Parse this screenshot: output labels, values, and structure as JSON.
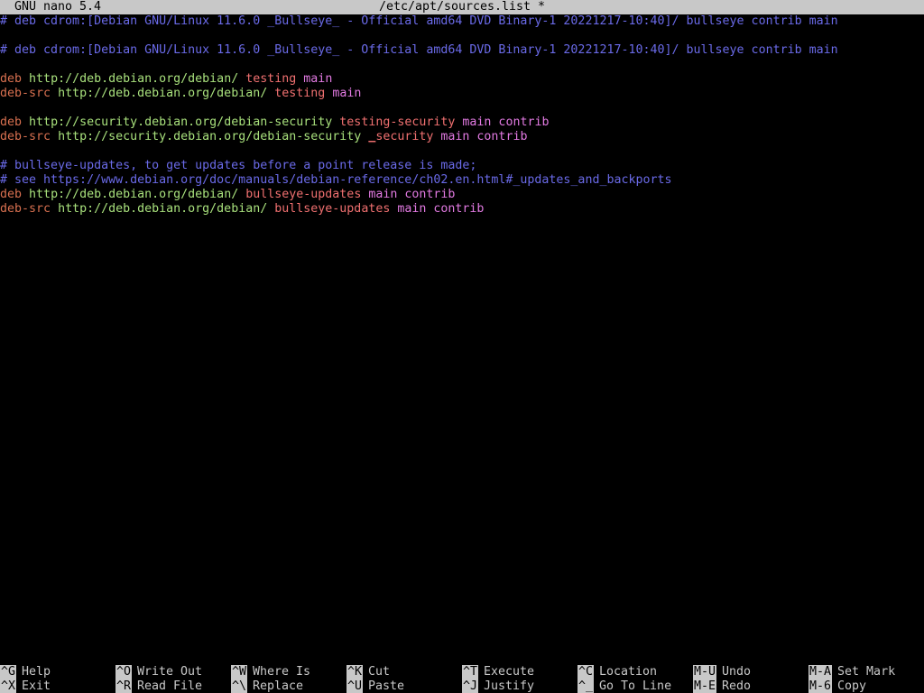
{
  "titlebar": {
    "app": "GNU nano 5.4",
    "file": "/etc/apt/sources.list *"
  },
  "editor": {
    "lines": [
      {
        "comment": "# deb cdrom:[Debian GNU/Linux 11.6.0 _Bullseye_ - Official amd64 DVD Binary-1 20221217-10:40]/ bullseye contrib main"
      },
      {
        "empty": ""
      },
      {
        "comment": "# deb cdrom:[Debian GNU/Linux 11.6.0 _Bullseye_ - Official amd64 DVD Binary-1 20221217-10:40]/ bullseye contrib main"
      },
      {
        "empty": ""
      },
      {
        "type": "deb",
        "url": "http://deb.debian.org/debian/",
        "dist": "testing",
        "components": "main"
      },
      {
        "type": "deb-src",
        "url": "http://deb.debian.org/debian/",
        "dist": "testing",
        "components": "main"
      },
      {
        "empty": ""
      },
      {
        "type": "deb",
        "url": "http://security.debian.org/debian-security",
        "dist": "testing-security",
        "components": "main contrib"
      },
      {
        "type": "deb-src",
        "url": "http://security.debian.org/debian-security",
        "dist_cursor": "_",
        "dist": "security",
        "components": "main contrib"
      },
      {
        "empty": ""
      },
      {
        "comment": "# bullseye-updates, to get updates before a point release is made;"
      },
      {
        "comment": "# see https://www.debian.org/doc/manuals/debian-reference/ch02.en.html#_updates_and_backports"
      },
      {
        "type": "deb",
        "url": "http://deb.debian.org/debian/",
        "dist": "bullseye-updates",
        "components": "main contrib"
      },
      {
        "type": "deb-src",
        "url": "http://deb.debian.org/debian/",
        "dist": "bullseye-updates",
        "components": "main contrib"
      }
    ]
  },
  "shortcuts": [
    {
      "key": "^G",
      "label": "Help"
    },
    {
      "key": "^X",
      "label": "Exit"
    },
    {
      "key": "^O",
      "label": "Write Out"
    },
    {
      "key": "^R",
      "label": "Read File"
    },
    {
      "key": "^W",
      "label": "Where Is"
    },
    {
      "key": "^\\",
      "label": "Replace"
    },
    {
      "key": "^K",
      "label": "Cut"
    },
    {
      "key": "^U",
      "label": "Paste"
    },
    {
      "key": "^T",
      "label": "Execute"
    },
    {
      "key": "^J",
      "label": "Justify"
    },
    {
      "key": "^C",
      "label": "Location"
    },
    {
      "key": "^_",
      "label": "Go To Line"
    },
    {
      "key": "M-U",
      "label": "Undo"
    },
    {
      "key": "M-E",
      "label": "Redo"
    },
    {
      "key": "M-A",
      "label": "Set Mark"
    },
    {
      "key": "M-6",
      "label": "Copy"
    }
  ],
  "colors": {
    "comment": "#6a6ae8",
    "type": "#d87050",
    "url": "#a8e07c",
    "dist": "#f07070",
    "components": "#e27ae2",
    "bar_bg": "#c8c8c8"
  }
}
